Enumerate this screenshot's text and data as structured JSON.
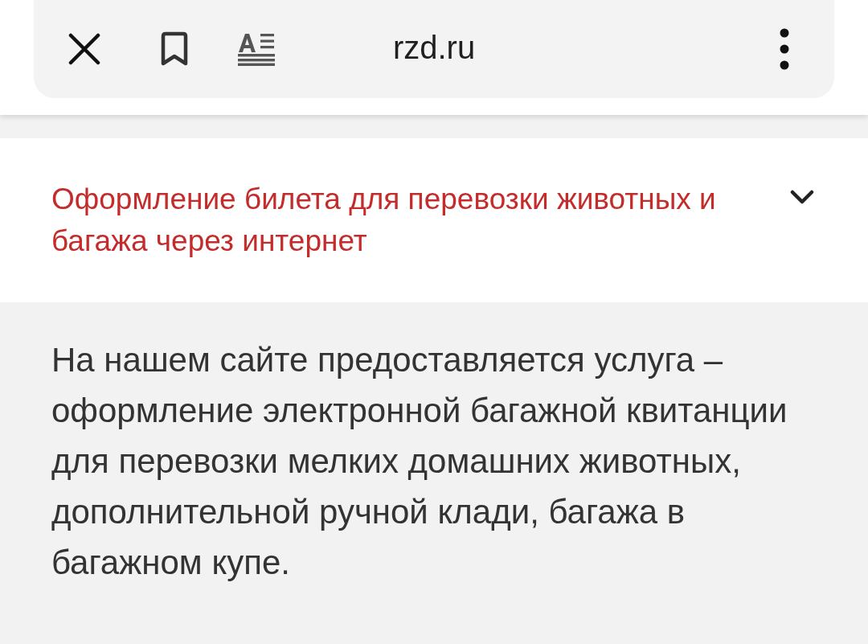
{
  "browser_bar": {
    "url": "rzd.ru"
  },
  "accordion": [
    {
      "title": "Оформление билета для перевозки животных и багажа через интернет",
      "expanded": true,
      "body": "На нашем сайте предоставляется услуга – оформление электронной багажной квитанции для перевозки мелких домашних животных, дополнительной ручной клади, багажа в багажном купе."
    }
  ]
}
